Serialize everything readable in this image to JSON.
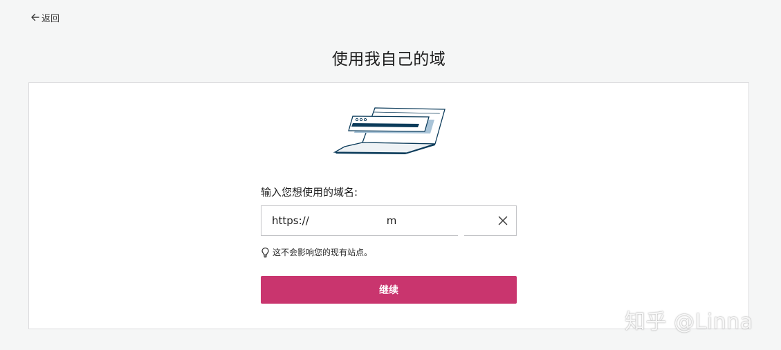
{
  "nav": {
    "back_label": "返回"
  },
  "page": {
    "title": "使用我自己的域"
  },
  "form": {
    "label": "输入您想使用的域名:",
    "input_prefix": "https://",
    "input_value": "m",
    "hint": "这不会影响您的现有站点。",
    "continue_label": "继续"
  },
  "watermark": {
    "text": "知乎 @Linna"
  },
  "colors": {
    "background": "#f5f6f6",
    "card": "#ffffff",
    "accent": "#c9356e",
    "illustration_dark": "#0b3b5a",
    "illustration_light": "#a9c4d8"
  }
}
